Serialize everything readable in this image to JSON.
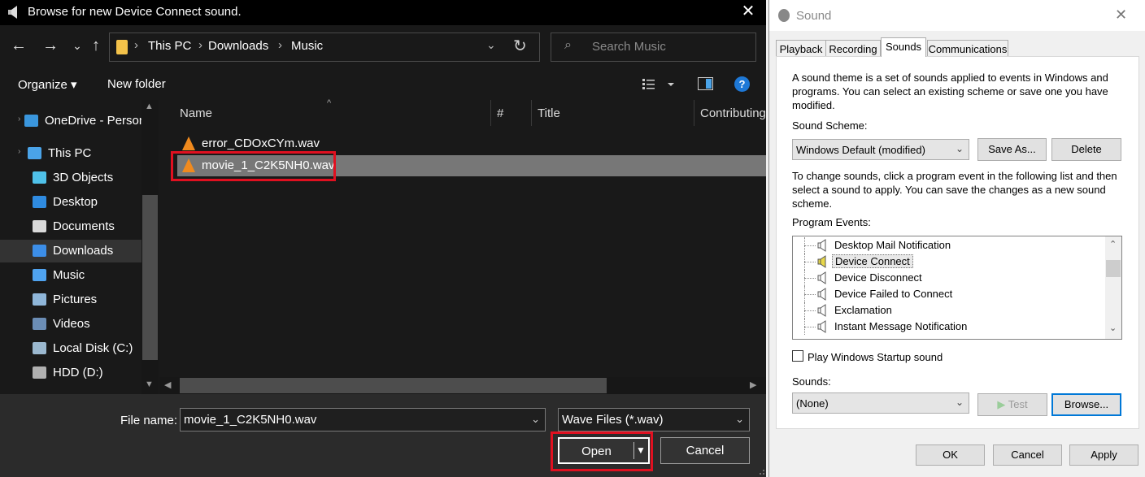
{
  "file_dialog": {
    "title": "Browse for new Device Connect sound.",
    "close_glyph": "✕",
    "nav": {
      "back": "←",
      "forward": "→",
      "recent": "⌄",
      "up": "↑"
    },
    "address": {
      "segments": [
        "This PC",
        "Downloads",
        "Music"
      ],
      "separator": "›",
      "refresh": "↻"
    },
    "search": {
      "placeholder": "Search Music",
      "icon": "⌕"
    },
    "toolbar": {
      "organize": "Organize ▾",
      "new_folder": "New folder",
      "help": "?"
    },
    "sidebar": [
      {
        "label": "OneDrive - Person",
        "icon": "cloud-icon",
        "color": "#3a96dd"
      },
      {
        "label": "This PC",
        "icon": "computer-icon",
        "color": "#4aa3e8"
      },
      {
        "label": "3D Objects",
        "icon": "cube-icon",
        "color": "#4fc1e9"
      },
      {
        "label": "Desktop",
        "icon": "desktop-icon",
        "color": "#2f8be0"
      },
      {
        "label": "Documents",
        "icon": "document-icon",
        "color": "#d9d9d9"
      },
      {
        "label": "Downloads",
        "icon": "download-icon",
        "color": "#3c8ee8"
      },
      {
        "label": "Music",
        "icon": "music-icon",
        "color": "#4fa3f0"
      },
      {
        "label": "Pictures",
        "icon": "picture-icon",
        "color": "#8fb6d9"
      },
      {
        "label": "Videos",
        "icon": "video-icon",
        "color": "#6b8db5"
      },
      {
        "label": "Local Disk (C:)",
        "icon": "drive-icon",
        "color": "#9bb8cf"
      },
      {
        "label": "HDD (D:)",
        "icon": "drive-icon",
        "color": "#b0b0b0"
      }
    ],
    "columns": [
      "Name",
      "#",
      "Title",
      "Contributing"
    ],
    "files": [
      "error_CDOxCYm.wav",
      "movie_1_C2K5NH0.wav"
    ],
    "filename_label": "File name:",
    "filename_value": "movie_1_C2K5NH0.wav",
    "filetype_value": "Wave Files (*.wav)",
    "open_label": "Open",
    "cancel_label": "Cancel"
  },
  "sound_dialog": {
    "title": "Sound",
    "close_glyph": "✕",
    "tabs": [
      "Playback",
      "Recording",
      "Sounds",
      "Communications"
    ],
    "intro": "A sound theme is a set of sounds applied to events in Windows and programs.  You can select an existing scheme or save one you have modified.",
    "scheme_label": "Sound Scheme:",
    "scheme_value": "Windows Default (modified)",
    "save_as": "Save As...",
    "delete": "Delete",
    "instructions": "To change sounds, click a program event in the following list and then select a sound to apply.  You can save the changes as a new sound scheme.",
    "events_label": "Program Events:",
    "events": [
      "Desktop Mail Notification",
      "Device Connect",
      "Device Disconnect",
      "Device Failed to Connect",
      "Exclamation",
      "Instant Message Notification"
    ],
    "startup_label": "Play Windows Startup sound",
    "sounds_label": "Sounds:",
    "sounds_value": "(None)",
    "test": "Test",
    "browse": "Browse...",
    "ok": "OK",
    "cancel": "Cancel",
    "apply": "Apply",
    "accent_color": "#0078d7"
  }
}
